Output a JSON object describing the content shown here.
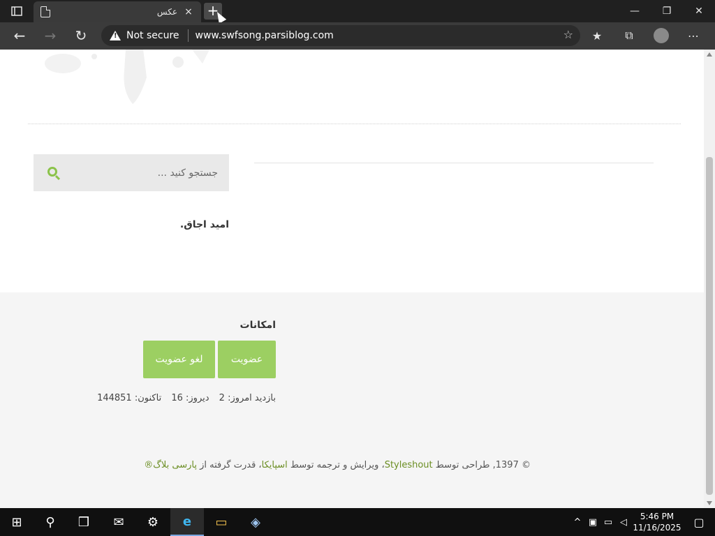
{
  "browser": {
    "tab_title": "عکس",
    "tab_close": "×",
    "new_tab": "+",
    "security_label": "Not secure",
    "url": "www.swfsong.parsiblog.com",
    "window_controls": {
      "minimize": "—",
      "maximize": "❐",
      "close": "✕"
    },
    "nav": {
      "back": "←",
      "forward": "→",
      "refresh": "↻"
    },
    "toolbar_icons": {
      "add_favorite": "☆",
      "favorites": "★",
      "collections": "⧉",
      "more": "⋯"
    }
  },
  "page": {
    "search": {
      "placeholder": "جستجو کنید ..."
    },
    "author": "امید اجاق.",
    "footer": {
      "features_title": "امکانات",
      "join_button": "عضویت",
      "leave_button": "لغو عضویت",
      "stats": {
        "today": "بازدید امروز: 2",
        "yesterday": "دیروز: 16",
        "total": "تاکنون: 144851"
      },
      "copyright": {
        "prefix": "© 1397, طراحی توسط",
        "designer": "Styleshout",
        "middle": "، ویرایش و ترجمه توسط",
        "translator": "اسپایکا",
        "powered": "، قدرت گرفته از",
        "platform": "پارسی بلاگ®"
      }
    }
  },
  "taskbar": {
    "start": "⊞",
    "search": "⚲",
    "task_view": "❒",
    "mail": "✉",
    "settings": "⚙",
    "edge": "e",
    "explorer": "▭",
    "app": "◈",
    "time": "5:46 PM",
    "date": "11/16/2025",
    "tray_up": "^",
    "notifications": "▢"
  },
  "colors": {
    "accent_green": "#9ccf62",
    "search_icon_green": "#8bc34a",
    "link_green": "#6b8e23"
  }
}
